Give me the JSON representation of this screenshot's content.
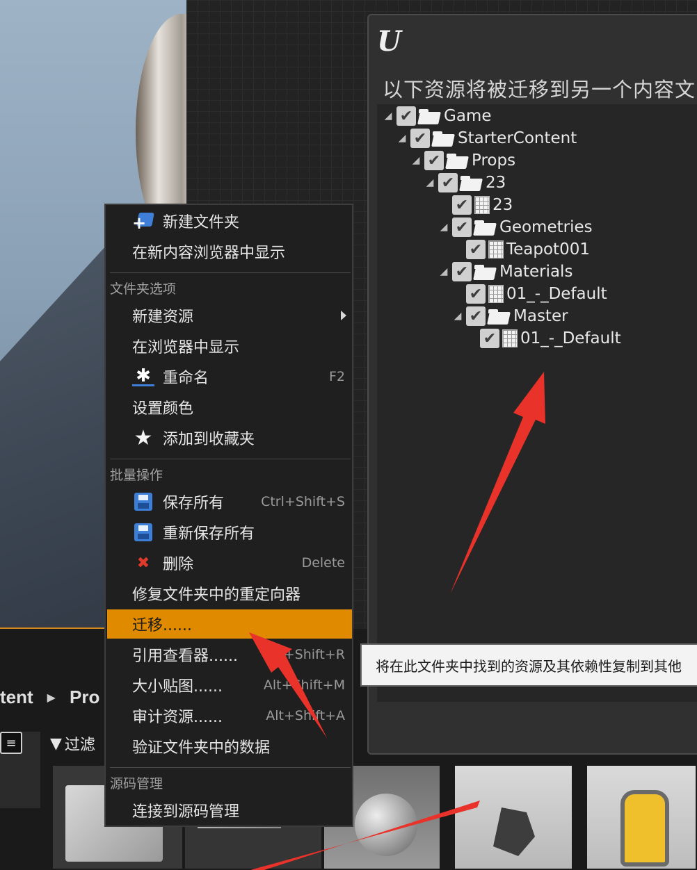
{
  "context_menu": {
    "items_top": [
      {
        "label": "新建文件夹",
        "icon": "new-folder-icon"
      },
      {
        "label": "在新内容浏览器中显示"
      }
    ],
    "section_folder": "文件夹选项",
    "items_folder": [
      {
        "label": "新建资源",
        "submenu": true
      },
      {
        "label": "在浏览器中显示"
      },
      {
        "label": "重命名",
        "shortcut": "F2",
        "icon": "rename-icon"
      },
      {
        "label": "设置颜色"
      },
      {
        "label": "添加到收藏夹",
        "icon": "star-icon"
      }
    ],
    "section_bulk": "批量操作",
    "items_bulk": [
      {
        "label": "保存所有",
        "shortcut": "Ctrl+Shift+S",
        "icon": "save-icon"
      },
      {
        "label": "重新保存所有",
        "icon": "save-icon"
      },
      {
        "label": "删除",
        "shortcut": "Delete",
        "icon": "delete-icon"
      },
      {
        "label": "修复文件夹中的重定向器"
      },
      {
        "label": "迁移......",
        "selected": true
      },
      {
        "label": "引用查看器......",
        "shortcut": "Alt+Shift+R"
      },
      {
        "label": "大小贴图......",
        "shortcut": "Alt+Shift+M"
      },
      {
        "label": "审计资源......",
        "shortcut": "Alt+Shift+A"
      },
      {
        "label": "验证文件夹中的数据"
      }
    ],
    "section_source": "源码管理",
    "items_source": [
      {
        "label": "连接到源码管理"
      }
    ]
  },
  "dialog": {
    "logo": "U",
    "heading": "以下资源将被迁移到另一个内容文",
    "tree": [
      {
        "label": "Game",
        "type": "folder",
        "depth": 0,
        "expanded": true,
        "checked": true
      },
      {
        "label": "StarterContent",
        "type": "folder",
        "depth": 1,
        "expanded": true,
        "checked": true
      },
      {
        "label": "Props",
        "type": "folder",
        "depth": 2,
        "expanded": true,
        "checked": true
      },
      {
        "label": "23",
        "type": "folder",
        "depth": 3,
        "expanded": true,
        "checked": true
      },
      {
        "label": "23",
        "type": "asset",
        "depth": 4,
        "checked": true
      },
      {
        "label": "Geometries",
        "type": "folder",
        "depth": 4,
        "expanded": true,
        "checked": true
      },
      {
        "label": "Teapot001",
        "type": "asset",
        "depth": 5,
        "checked": true
      },
      {
        "label": "Materials",
        "type": "folder",
        "depth": 4,
        "expanded": true,
        "checked": true
      },
      {
        "label": "01_-_Default",
        "type": "asset",
        "depth": 5,
        "checked": true
      },
      {
        "label": "Master",
        "type": "folder",
        "depth": 5,
        "expanded": true,
        "checked": true
      },
      {
        "label": "01_-_Default",
        "type": "asset",
        "depth": 6,
        "checked": true
      }
    ]
  },
  "tooltip": {
    "text": "将在此文件夹中找到的资源及其依赖性复制到其他"
  },
  "content_browser": {
    "path": [
      "tent",
      "Pro"
    ],
    "filter_label": "过滤"
  },
  "colors": {
    "menu_highlight": "#e08a00",
    "annotation_arrow": "#e8322a"
  }
}
